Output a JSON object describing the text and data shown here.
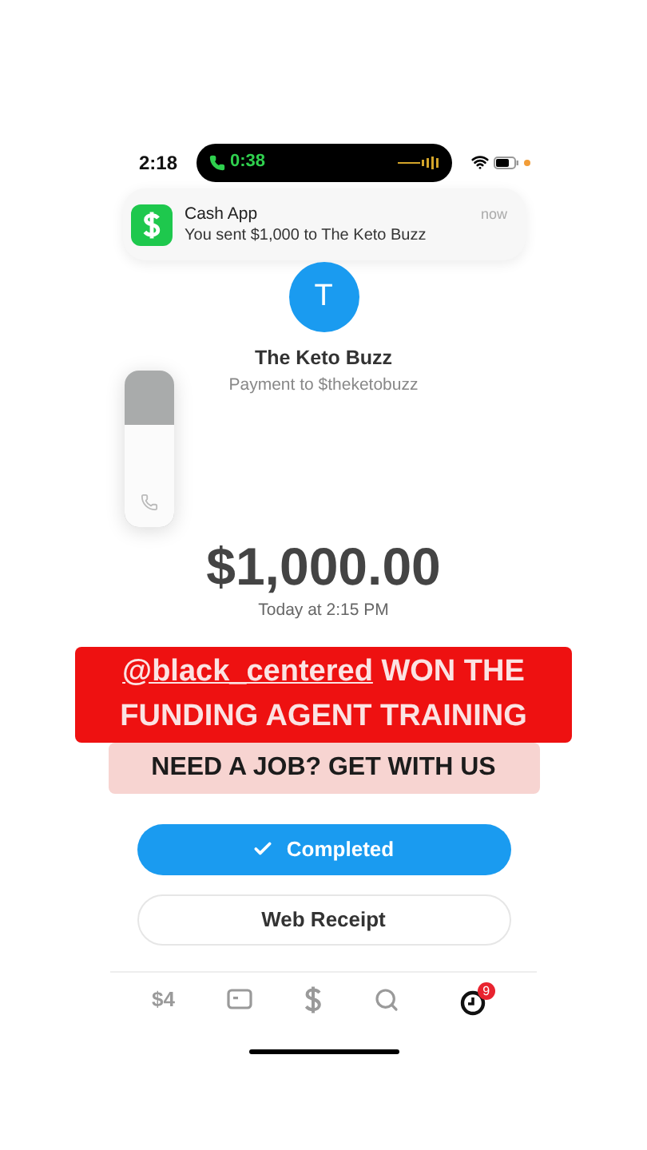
{
  "status_bar": {
    "time": "2:18",
    "call_timer": "0:38"
  },
  "notification": {
    "app": "Cash App",
    "message": "You sent $1,000 to The Keto Buzz",
    "time": "now"
  },
  "payment": {
    "avatar_letter": "T",
    "name": "The Keto Buzz",
    "subtitle": "Payment to $theketobuzz",
    "amount": "$1,000.00",
    "date": "Today at 2:15 PM"
  },
  "volume": {
    "level": 0.65
  },
  "caption": {
    "handle": "@black_centered",
    "line1_rest": "WON THE",
    "line2": "FUNDING AGENT TRAINING",
    "line3": "NEED A JOB? GET WITH US"
  },
  "buttons": [
    {
      "kind": "primary",
      "label": "Completed"
    },
    {
      "kind": "secondary",
      "label": "Web Receipt"
    }
  ],
  "tabs": [
    {
      "kind": "balance",
      "label": "$4",
      "selected": false
    },
    {
      "kind": "card",
      "selected": false
    },
    {
      "kind": "dollar",
      "selected": false
    },
    {
      "kind": "search",
      "selected": false
    },
    {
      "kind": "activity",
      "badge": "9",
      "selected": true
    }
  ]
}
